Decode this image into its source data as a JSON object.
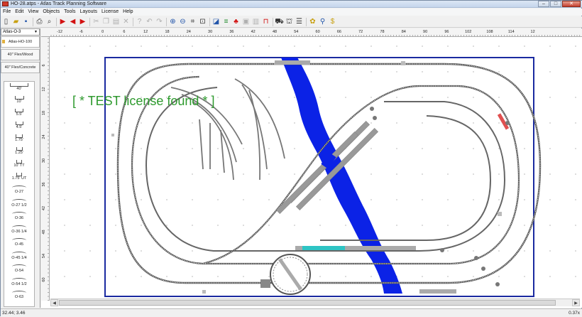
{
  "window": {
    "title": "HO-28.atps - Atlas Track Planning Software"
  },
  "menu": [
    "File",
    "Edit",
    "View",
    "Objects",
    "Tools",
    "Layouts",
    "License",
    "Help"
  ],
  "toolbar_icons": [
    "new-icon",
    "open-icon",
    "save-icon",
    "print-icon",
    "print-preview-icon",
    "play-icon",
    "step-back-icon",
    "step-forward-icon",
    "cut-icon",
    "copy-icon",
    "paste-icon",
    "delete-icon",
    "help-icon",
    "undo-icon",
    "redo-icon",
    "zoom-in-icon",
    "zoom-out-icon",
    "zoom-fit-icon",
    "zoom-window-icon",
    "layer-icon",
    "track-color-icon",
    "tree-icon",
    "flex-icon",
    "scenery-icon",
    "measure-icon",
    "train-icon",
    "bridge-icon",
    "menu-drop-icon",
    "parts-icon",
    "search-icon",
    "bom-icon"
  ],
  "library": {
    "selected": "Atlas-O-3",
    "tabs": [
      "Atlas-HO-100",
      "40\" Flex/Wood",
      "40\" Flex/Concrete"
    ]
  },
  "parts": [
    "40'",
    "10'",
    "5.5'",
    "4.5'",
    "1.75'",
    "1.25'",
    "10' TT",
    "1.75' UT",
    "O-27",
    "O-27 1/2",
    "O-36",
    "O-36 1/4",
    "O-45",
    "O-45 1/4",
    "O-54",
    "O-54 1/2",
    "O-63"
  ],
  "ruler": {
    "top": [
      "-12",
      "-6",
      "0",
      "6",
      "12",
      "18",
      "24",
      "30",
      "36",
      "42",
      "48",
      "54",
      "60",
      "66",
      "72",
      "78",
      "84",
      "90",
      "96",
      "102",
      "108",
      "114",
      "12"
    ],
    "left": [
      "6",
      "12",
      "18",
      "24",
      "30",
      "36",
      "42",
      "48",
      "54",
      "60"
    ]
  },
  "license_banner": "[ * TEST license found * ]",
  "status": {
    "coords": "32.44; 3.46",
    "zoom": "0.37x"
  },
  "colors": {
    "river": "#0b22e6",
    "border": "#1a2aa0",
    "highlight_track": "#2ec4c4",
    "red_track": "#e05050",
    "banner": "#2e9a2e"
  }
}
